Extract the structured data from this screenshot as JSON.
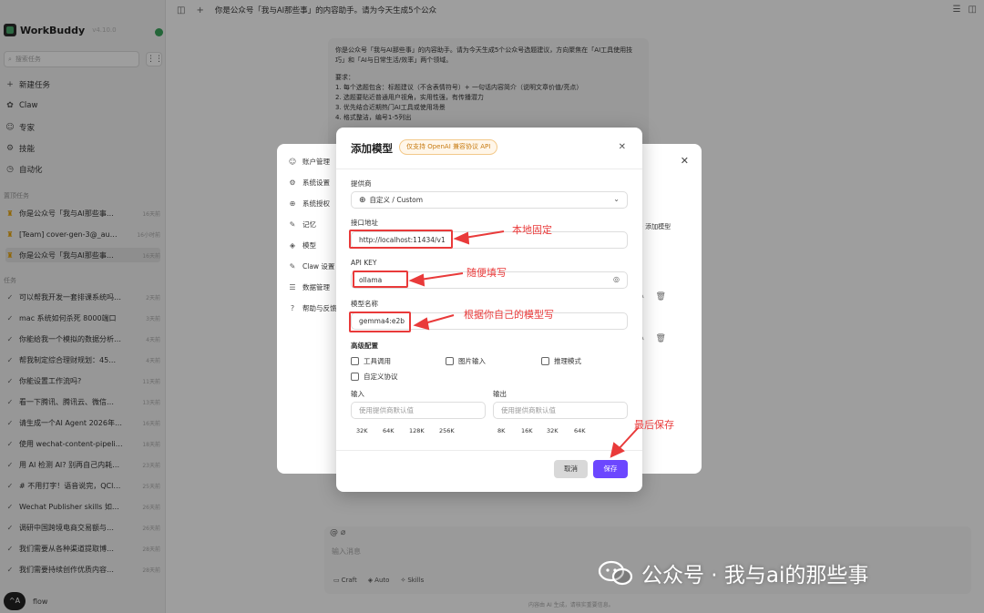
{
  "app": {
    "name": "WorkBuddy",
    "version": "v4.10.0"
  },
  "search": {
    "placeholder": "搜索任务"
  },
  "nav": [
    {
      "icon": "+",
      "label": "新建任务"
    },
    {
      "icon": "✿",
      "label": "Claw"
    },
    {
      "icon": "☺",
      "label": "专家"
    },
    {
      "icon": "⚙",
      "label": "技能"
    },
    {
      "icon": "◷",
      "label": "自动化"
    }
  ],
  "recent_label": "置顶任务",
  "recent": [
    {
      "label": "你是公众号「我与AI那些事…",
      "time": "16天前"
    },
    {
      "label": "[Team] cover-gen-3@_au…",
      "time": "16小时前"
    },
    {
      "label": "你是公众号「我与AI那些事…",
      "time": "16天前"
    }
  ],
  "tasks_label": "任务",
  "tasks": [
    {
      "label": "可以帮我开发一套排课系统吗…",
      "time": "2天前"
    },
    {
      "label": "mac 系统如何杀死 8000端口",
      "time": "3天前"
    },
    {
      "label": "你能给我一个模拟的数据分析…",
      "time": "4天前"
    },
    {
      "label": "帮我制定综合理财规划：45…",
      "time": "4天前"
    },
    {
      "label": "你能设置工作流吗?",
      "time": "11天前"
    },
    {
      "label": "看一下腾讯、腾讯云、微信…",
      "time": "13天前"
    },
    {
      "label": "请生成一个AI Agent 2026年…",
      "time": "16天前"
    },
    {
      "label": "使用 wechat-content-pipeli…",
      "time": "18天前"
    },
    {
      "label": "用 AI 检测 AI? 别再自己内耗…",
      "time": "23天前"
    },
    {
      "label": "# 不用打字！语音说完，QCl…",
      "time": "25天前"
    },
    {
      "label": "Wechat Publisher skills 如…",
      "time": "26天前"
    },
    {
      "label": "调研中国跨境电商交易额与…",
      "time": "26天前"
    },
    {
      "label": "我们需要从各种渠道提取博…",
      "time": "28天前"
    },
    {
      "label": "我们需要持续创作优质内容…",
      "time": "28天前"
    }
  ],
  "user": {
    "avatar": "^A",
    "name": "flow"
  },
  "topbar": {
    "title": "你是公众号「我与AI那些事」的内容助手。请为今天生成5个公众"
  },
  "prompt": {
    "lines": [
      "你是公众号「我与AI那些事」的内容助手。请为今天生成5个公众号选题建议，方向聚焦在「AI工具使用技巧」和「AI与日常生活/效率」两个领域。",
      "",
      "要求：",
      "1. 每个选题包含：标题建议（不含表情符号）+ 一句话内容简介（说明文章价值/亮点）",
      "2. 选题要贴近普通用户视角，实用性强，有传播潜力",
      "3. 优先结合近期热门AI工具或使用场景",
      "4. 格式整洁，编号1-5列出"
    ]
  },
  "settings": {
    "items": [
      {
        "icon": "☺",
        "label": "账户管理"
      },
      {
        "icon": "⚙",
        "label": "系统设置"
      },
      {
        "icon": "⊕",
        "label": "系统授权"
      },
      {
        "icon": "✎",
        "label": "记忆"
      },
      {
        "icon": "◈",
        "label": "模型"
      },
      {
        "icon": "✎",
        "label": "Claw 设置"
      },
      {
        "icon": "☰",
        "label": "数据管理"
      },
      {
        "icon": "?",
        "label": "帮助与反馈"
      }
    ],
    "add_model": "+ 添加模型"
  },
  "chat": {
    "placeholder": "输入消息",
    "tools": [
      "Craft",
      "Auto",
      "Skills"
    ],
    "footer": "内容由 AI 生成，请核实重要信息。"
  },
  "modal": {
    "title": "添加模型",
    "badge": "仅支持 OpenAI 兼容协议 API",
    "provider_label": "提供商",
    "provider_value": "自定义 / Custom",
    "endpoint_label": "接口地址",
    "endpoint_value": "http://localhost:11434/v1",
    "apikey_label": "API KEY",
    "apikey_value": "ollama",
    "model_label": "模型名称",
    "model_value": "gemma4:e2b",
    "advanced_label": "高级配置",
    "checks": [
      "工具调用",
      "图片输入",
      "推理模式",
      "自定义协议"
    ],
    "input_label": "输入",
    "output_label": "输出",
    "input_placeholder": "使用提供商默认值",
    "output_placeholder": "使用提供商默认值",
    "input_presets": [
      "32K",
      "64K",
      "128K",
      "256K"
    ],
    "output_presets": [
      "8K",
      "16K",
      "32K",
      "64K"
    ],
    "cancel": "取消",
    "save": "保存"
  },
  "annotations": {
    "endpoint": "本地固定",
    "apikey": "随便填写",
    "model": "根据你自己的模型写",
    "save": "最后保存"
  },
  "watermark": "公众号 · 我与ai的那些事",
  "colors": {
    "accent": "#6c47ff",
    "annotation": "#e93a3a",
    "badge": "#c77b12",
    "online": "#3aa55d"
  }
}
